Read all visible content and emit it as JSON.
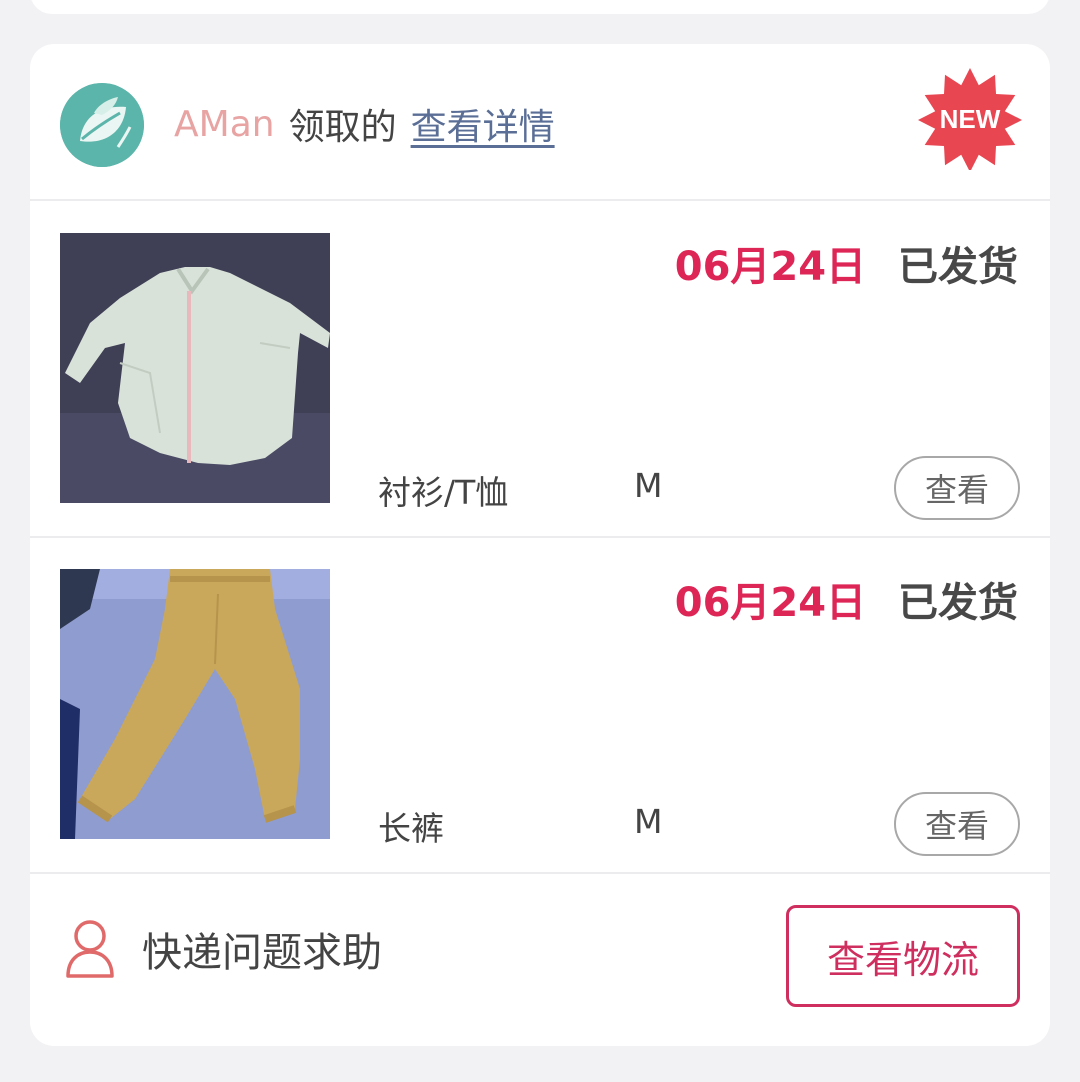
{
  "header": {
    "user_name": "AMan",
    "action": "领取的",
    "detail_link": "查看详情",
    "badge": "NEW"
  },
  "items": [
    {
      "date": "06月24日",
      "status": "已发货",
      "category": "衬衫/T恤",
      "size": "M",
      "view_label": "查看"
    },
    {
      "date": "06月24日",
      "status": "已发货",
      "category": "长裤",
      "size": "M",
      "view_label": "查看"
    }
  ],
  "footer": {
    "help_label": "快递问题求助",
    "logistics_button": "查看物流"
  },
  "colors": {
    "accent": "#dd2556",
    "button_border": "#cf2f5f",
    "avatar_bg": "#5cb5aa",
    "badge_red": "#e84651",
    "link": "#5a6e96",
    "user_name": "#e8a3a3"
  },
  "icons": {
    "avatar": "leaf-logo",
    "badge": "starburst-new-badge",
    "help": "person-outline-icon"
  }
}
